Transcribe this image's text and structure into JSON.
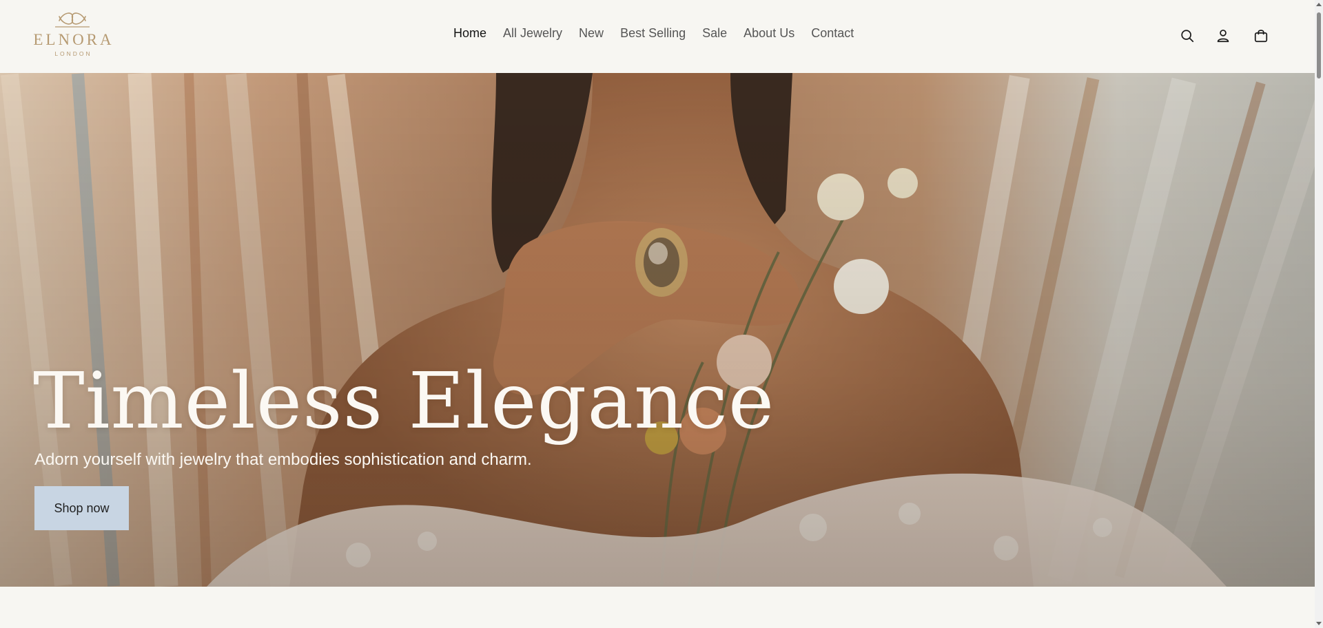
{
  "brand": {
    "name": "ELNORA",
    "tagline": "LONDON",
    "color": "#b69a72"
  },
  "nav": {
    "items": [
      {
        "label": "Home",
        "active": true
      },
      {
        "label": "All Jewelry"
      },
      {
        "label": "New"
      },
      {
        "label": "Best Selling"
      },
      {
        "label": "Sale"
      },
      {
        "label": "About Us"
      },
      {
        "label": "Contact"
      }
    ]
  },
  "header_icons": {
    "search": "search-icon",
    "account": "user-icon",
    "cart": "shopping-bag-icon"
  },
  "hero": {
    "title": "Timeless Elegance",
    "subtitle": "Adorn yourself with jewelry that embodies sophistication and charm.",
    "cta_label": "Shop now",
    "cta_color": "#c8d5e3"
  },
  "colors": {
    "page_bg": "#f7f6f2",
    "text_primary": "#141414",
    "text_nav": "#555555"
  }
}
